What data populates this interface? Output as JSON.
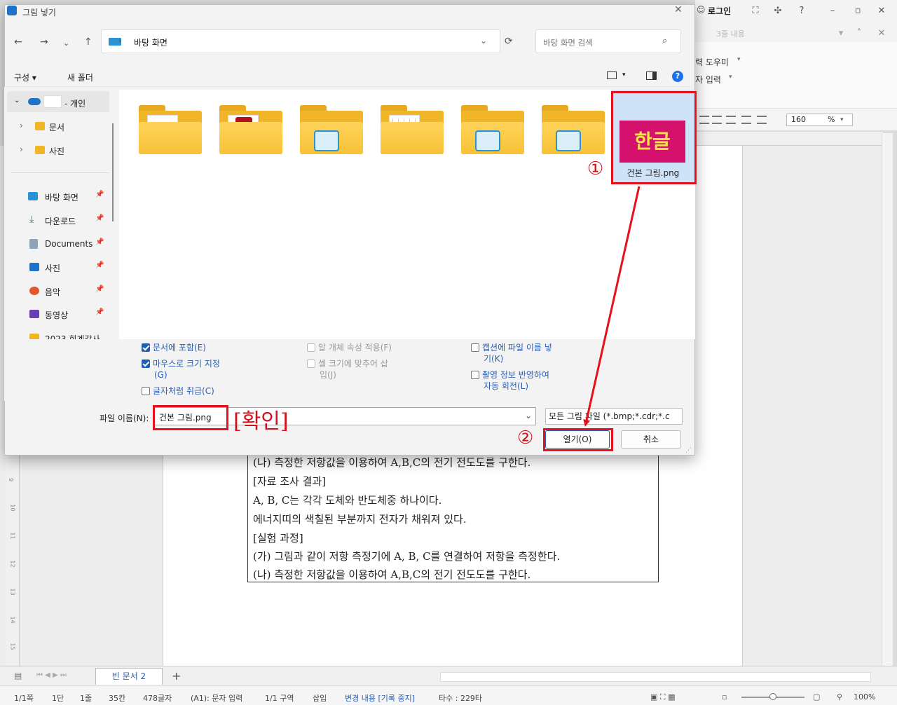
{
  "dialog": {
    "title": "그림 넣기",
    "address_path": "바탕 화면",
    "search_placeholder": "바탕 화면 검색",
    "organize_label": "구성 ▾",
    "new_folder_label": "새 폴더",
    "help_label": "?"
  },
  "nav": {
    "items": [
      {
        "label": "- 개인",
        "icon": "onedrive-icon"
      },
      {
        "label": "문서",
        "icon": "folder-icon"
      },
      {
        "label": "사진",
        "icon": "folder-icon"
      },
      {
        "label": "바탕 화면",
        "icon": "desktop-icon"
      },
      {
        "label": "다운로드",
        "icon": "download-icon"
      },
      {
        "label": "Documents",
        "icon": "documents-icon"
      },
      {
        "label": "사진",
        "icon": "pictures-icon"
      },
      {
        "label": "음악",
        "icon": "music-icon"
      },
      {
        "label": "동영상",
        "icon": "video-icon"
      },
      {
        "label": "2023 회계감사",
        "icon": "folder-icon"
      }
    ]
  },
  "files": {
    "selected_file": {
      "name": "건본 그림.png",
      "thumbnail_text": "한글"
    }
  },
  "options": {
    "include_in_doc": "문서에 포함(E)",
    "mouse_size": "마우스로 크기 지정",
    "mouse_size_key": "(G)",
    "as_char": "글자처럼 취급(C)",
    "object_attr": "알 개체 속성 적용(F)",
    "fit_cell": "셀 크기에 맞추어 삽",
    "fit_cell_2": "입(J)",
    "caption_file": "캡션에 파일 이름 넣",
    "caption_file_2": "기(K)",
    "rotate_info": "촬영 정보 반영하여",
    "rotate_info_2": "자동 회전(L)"
  },
  "filename": {
    "label": "파일 이름(N):",
    "value": "건본 그림.png",
    "filter": "모든 그림 파일 (*.bmp;*.cdr;*.c"
  },
  "buttons": {
    "open": "열기(O)",
    "cancel": "취소"
  },
  "annotations": {
    "step1": "①",
    "step2": "②",
    "confirm": "[확인]"
  },
  "app": {
    "login": "로그인",
    "faded_text": "3줄 내용",
    "ribbon_1": "력 도우미",
    "ribbon_2": "자 입력",
    "zoom_field": "160",
    "zoom_unit": "%",
    "tab_name": "빈 문서 2",
    "tab_add": "+"
  },
  "document": {
    "lines": [
      "(나) 측정한 저항값을 이용하여 A,B,C의 전기 전도도를 구한다.",
      "[자료 조사 결과]",
      "A, B, C는 각각 도체와 반도체중 하나이다.",
      "에너지띠의 색칠된 부분까지 전자가 채워져 있다.",
      "[실험 과정]",
      "(가) 그림과 같이 저항 측정기에 A, B, C를 연결하여 저항을 측정한다.",
      "(나) 측정한 저항값을 이용하여 A,B,C의 전기 전도도를 구한다."
    ]
  },
  "ruler": {
    "numbers": [
      "9",
      "10",
      "11",
      "12",
      "13",
      "14",
      "15"
    ]
  },
  "status": {
    "page": "1/1쪽",
    "col": "1단",
    "line": "1줄",
    "pos": "35칸",
    "chars": "478글자",
    "mode": "(A1): 문자 입력",
    "section": "1/1 구역",
    "insert": "삽입",
    "track": "변경 내용 [기록 중지]",
    "typing": "타수 : 229타",
    "zoom": "100%"
  },
  "colors": {
    "accent": "#1a5fb4",
    "annotation_red": "#e5121b",
    "thumb_bg": "#d4126e"
  }
}
